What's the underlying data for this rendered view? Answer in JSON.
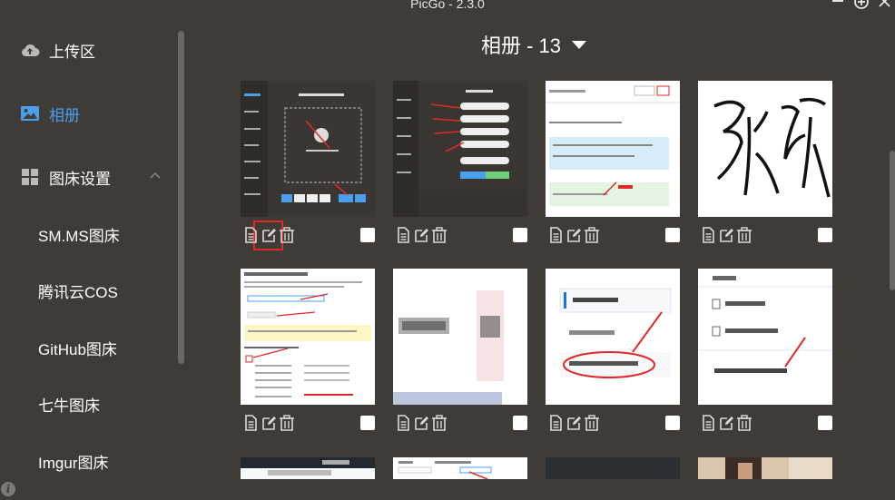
{
  "app": {
    "title": "PicGo - 2.3.0",
    "window_controls": [
      "minimize",
      "maximize",
      "close"
    ]
  },
  "sidebar": {
    "upload": {
      "label": "上传区",
      "icon": "cloud-upload-icon"
    },
    "gallery": {
      "label": "相册",
      "icon": "image-icon",
      "active": true
    },
    "settings": {
      "label": "图床设置",
      "icon": "grid-icon",
      "expanded": true
    },
    "hosts": [
      "SM.MS图床",
      "腾讯云COS",
      "GitHub图床",
      "七牛图床",
      "Imgur图床"
    ]
  },
  "gallery": {
    "title": "相册 - 13",
    "item_actions": [
      "copy-link-icon",
      "edit-icon",
      "delete-icon"
    ],
    "highlighted_edit_index": 0
  },
  "colors": {
    "background": "#3f3c37",
    "active": "#4aa0ef",
    "highlight": "#e02a2a"
  }
}
